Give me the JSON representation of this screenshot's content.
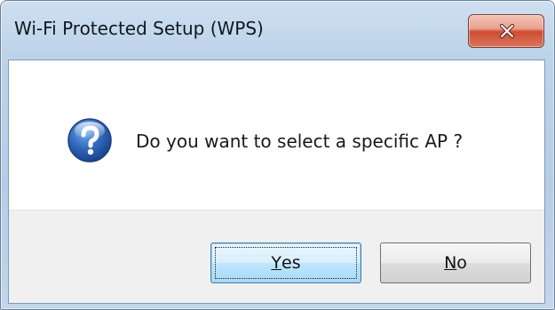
{
  "window": {
    "title": "Wi-Fi Protected Setup (WPS)"
  },
  "dialog": {
    "icon": "question-icon",
    "message": "Do you want to select a specific AP ?"
  },
  "buttons": {
    "yes": {
      "mnemonic": "Y",
      "rest": "es",
      "label": "Yes"
    },
    "no": {
      "mnemonic": "N",
      "rest": "o",
      "label": "No"
    }
  },
  "colors": {
    "title_bar": "#bcd3ea",
    "close_button": "#cf4d31",
    "button_area": "#f0f0f0",
    "default_button_border": "#3c7fb1"
  }
}
